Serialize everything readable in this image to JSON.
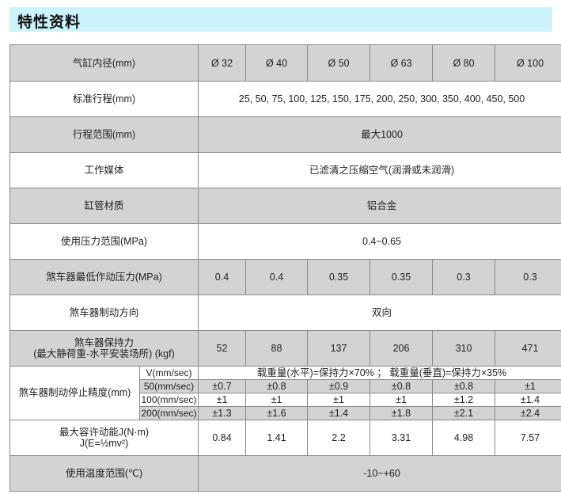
{
  "section_title": "特性资料",
  "rows": {
    "bore": {
      "label": "气缸内径(mm)",
      "values": [
        "Ø 32",
        "Ø 40",
        "Ø 50",
        "Ø 63",
        "Ø 80",
        "Ø 100"
      ]
    },
    "stroke": {
      "label": "标准行程(mm)",
      "value": "25, 50, 75, 100, 125, 150, 175, 200, 250, 300, 350, 400, 450, 500"
    },
    "stroke_range": {
      "label": "行程范围(mm)",
      "value": "最大1000"
    },
    "medium": {
      "label": "工作媒体",
      "value": "已滤清之压缩空气(润滑或未润滑)"
    },
    "tube_material": {
      "label": "缸管材质",
      "value": "铝合金"
    },
    "pressure_range": {
      "label": "使用压力范围(MPa)",
      "value": "0.4~0.65"
    },
    "brake_min_pressure": {
      "label": "煞车器最低作动压力(MPa)",
      "values": [
        "0.4",
        "0.4",
        "0.35",
        "0.35",
        "0.3",
        "0.3"
      ]
    },
    "brake_direction": {
      "label": "煞车器制动方向",
      "value": "双向"
    },
    "holding_force": {
      "label_line1": "煞车器保持力",
      "label_line2": "(最大静荷重-水平安装场所) (kgf)",
      "values": [
        "52",
        "88",
        "137",
        "206",
        "310",
        "471"
      ]
    },
    "stop_accuracy": {
      "label": "煞车器制动停止精度(mm)",
      "velocity_label": "V(mm/sec)",
      "velocity_note": "载重量(水平)=保持力×70% ； 载重量(垂直)=保持力×35%",
      "rows": [
        {
          "speed": "50(mm/sec)",
          "values": [
            "±0.7",
            "±0.8",
            "±0.9",
            "±0.8",
            "±0.8",
            "±1"
          ]
        },
        {
          "speed": "100(mm/sec)",
          "values": [
            "±1",
            "±1",
            "±1",
            "±1",
            "±1.2",
            "±1.4"
          ]
        },
        {
          "speed": "200(mm/sec)",
          "values": [
            "±1.3",
            "±1.6",
            "±1.4",
            "±1.8",
            "±2.1",
            "±2.4"
          ]
        }
      ]
    },
    "kinetic_energy": {
      "label_line1": "最大容许动能J(N·m)",
      "label_line2": "J(E=½mv²)",
      "values": [
        "0.84",
        "1.41",
        "2.2",
        "3.31",
        "4.98",
        "7.57"
      ]
    },
    "temperature": {
      "label": "使用温度范围(℃)",
      "value": "-10~+60"
    }
  }
}
